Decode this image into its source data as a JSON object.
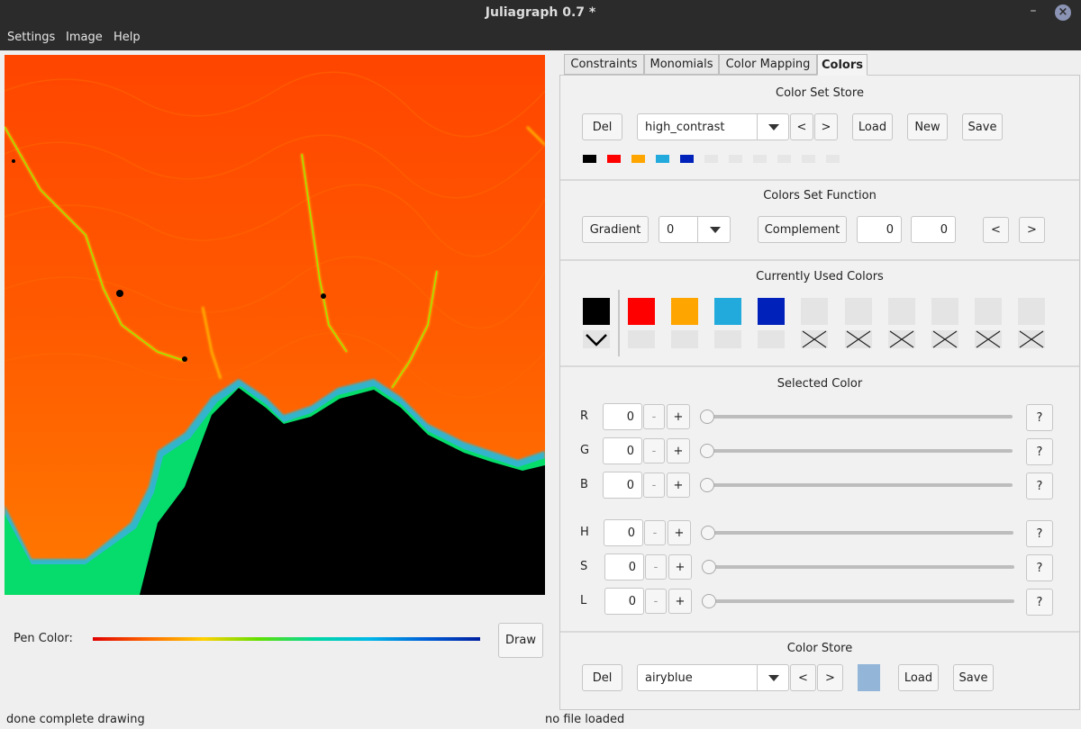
{
  "window": {
    "title": "Juliagraph 0.7 *",
    "minimize_glyph": "–",
    "close_glyph": "×"
  },
  "menu": [
    "Settings",
    "Image",
    "Help"
  ],
  "canvas": {
    "pen_color_label": "Pen Color:",
    "draw_label": "Draw"
  },
  "tabs": [
    "Constraints",
    "Monomials",
    "Color Mapping",
    "Colors"
  ],
  "color_set_store": {
    "title": "Color Set Store",
    "del_label": "Del",
    "selected": "high_contrast",
    "prev_label": "<",
    "next_label": ">",
    "load_label": "Load",
    "new_label": "New",
    "save_label": "Save",
    "swatches": [
      "#000000",
      "#ff0000",
      "#ffa500",
      "#22aadd",
      "#0022bb",
      "#e6e6e6",
      "#e6e6e6",
      "#e6e6e6",
      "#e6e6e6",
      "#e6e6e6",
      "#e6e6e6"
    ]
  },
  "colors_set_function": {
    "title": "Colors Set Function",
    "gradient_label": "Gradient",
    "gradient_value": "0",
    "complement_label": "Complement",
    "value_a": "0",
    "value_b": "0",
    "prev_label": "<",
    "next_label": ">"
  },
  "currently_used": {
    "title": "Currently Used Colors",
    "colors": [
      "#000000",
      "#ff0000",
      "#ffa500",
      "#22aadd",
      "#0022bb",
      "#e4e4e4",
      "#e4e4e4",
      "#e4e4e4",
      "#e4e4e4",
      "#e4e4e4",
      "#e4e4e4"
    ]
  },
  "selected_color": {
    "title": "Selected Color",
    "rows": [
      {
        "label": "R",
        "value": "0"
      },
      {
        "label": "G",
        "value": "0"
      },
      {
        "label": "B",
        "value": "0"
      },
      {
        "label": "H",
        "value": "0"
      },
      {
        "label": "S",
        "value": "0"
      },
      {
        "label": "L",
        "value": "0"
      }
    ],
    "minus_label": "-",
    "plus_label": "+",
    "help_label": "?"
  },
  "color_store": {
    "title": "Color Store",
    "del_label": "Del",
    "selected": "airyblue",
    "prev_label": "<",
    "next_label": ">",
    "preview_color": "#93b6d8",
    "load_label": "Load",
    "save_label": "Save"
  },
  "status": {
    "left": "done complete drawing",
    "right": "no file loaded"
  }
}
